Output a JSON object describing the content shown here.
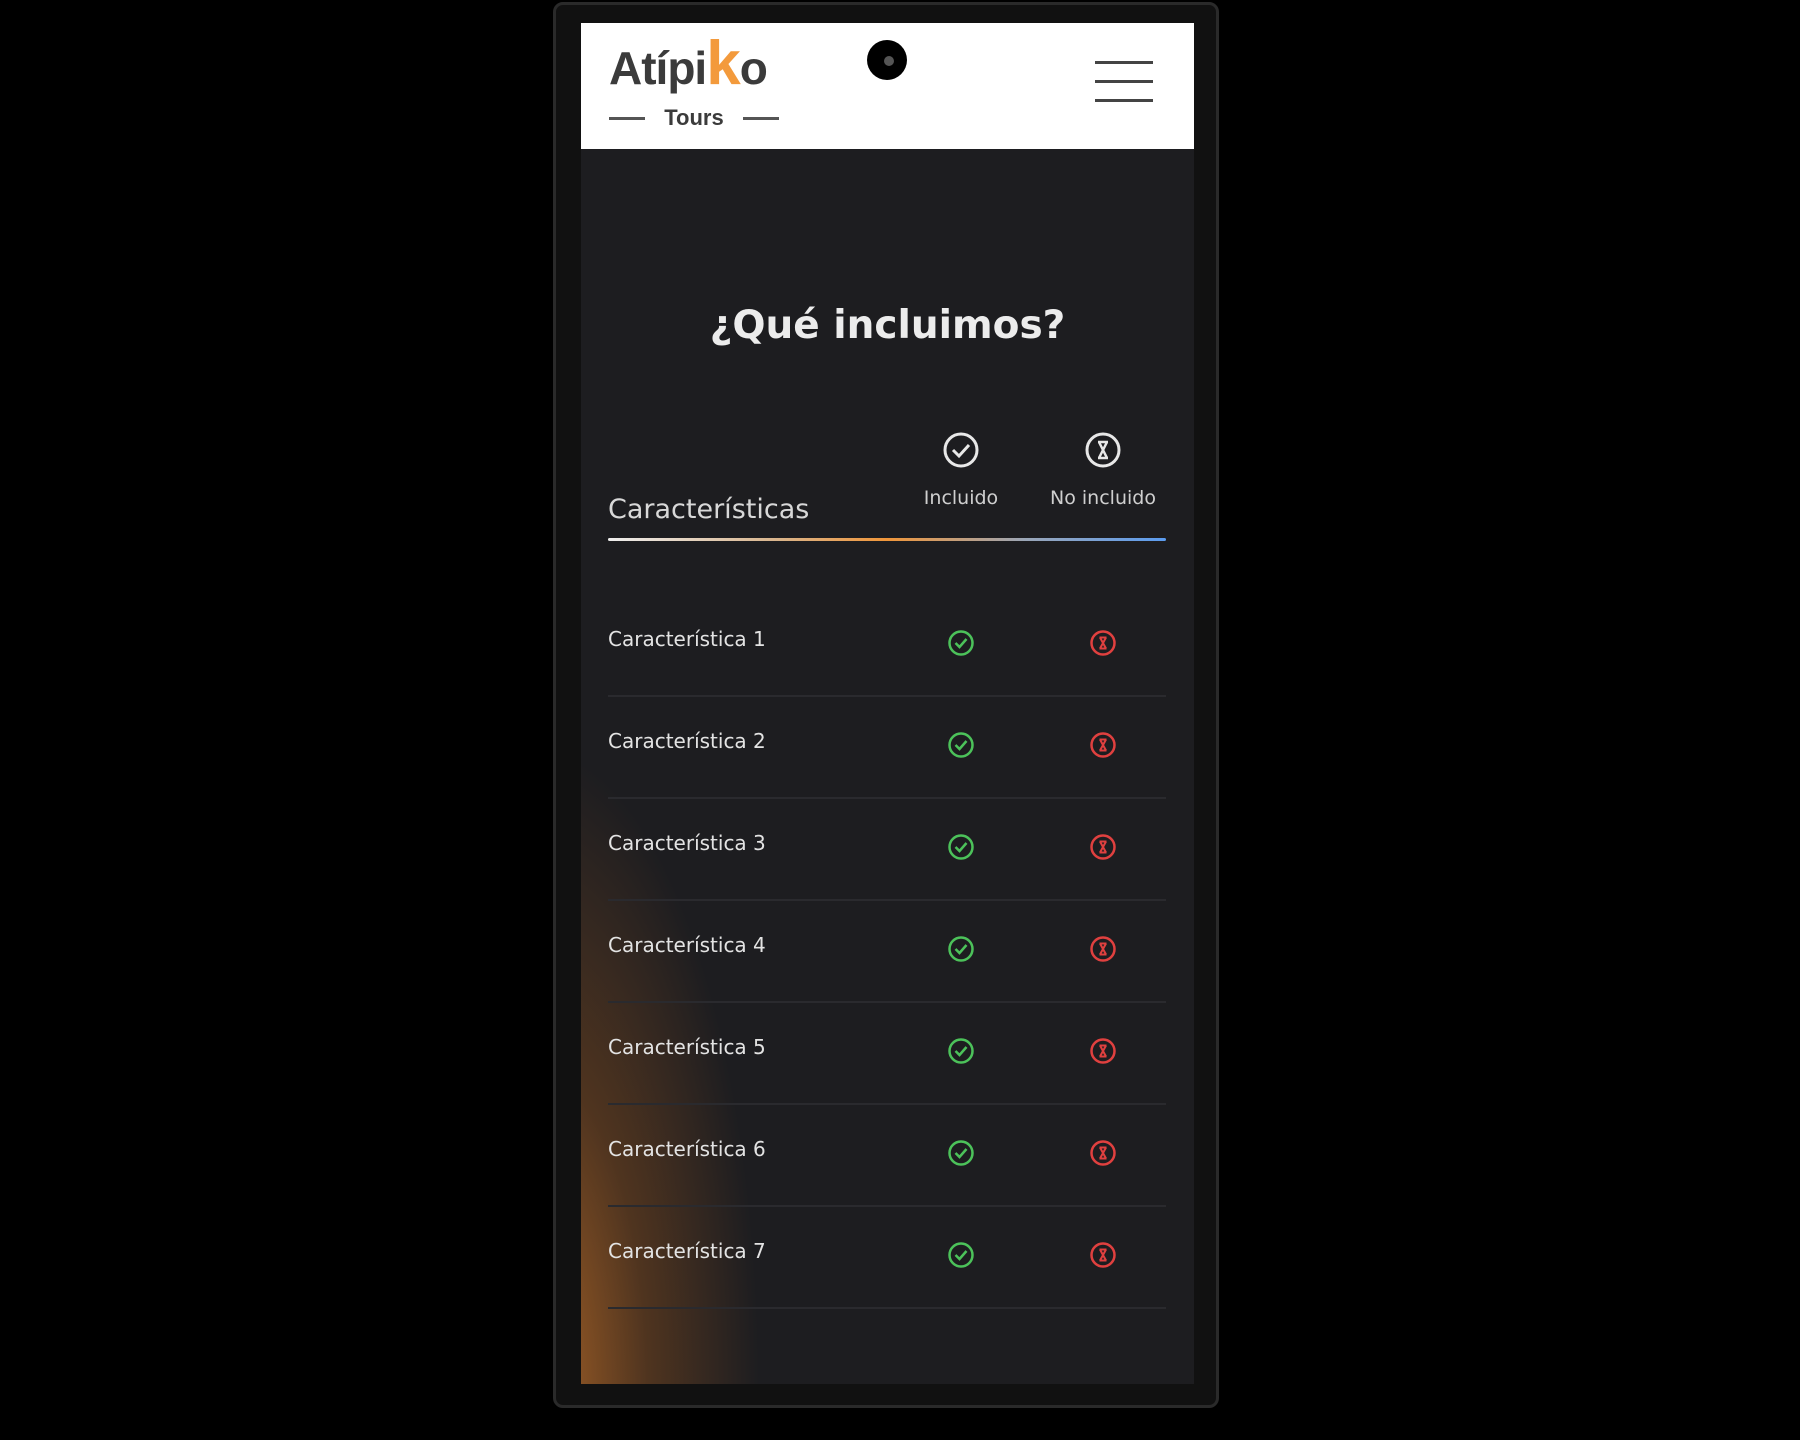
{
  "header": {
    "logo": {
      "text_main": "Atípi",
      "text_k": "k",
      "text_end": "o",
      "text_sub": "Tours"
    },
    "menu_icon": "hamburger-icon"
  },
  "section": {
    "title": "¿Qué incluimos?"
  },
  "table": {
    "feature_header": "Características",
    "columns": [
      {
        "label": "Incluido",
        "icon": "check-circle-icon"
      },
      {
        "label": "No incluido",
        "icon": "x-circle-icon"
      }
    ],
    "rows": [
      {
        "label": "Característica 1"
      },
      {
        "label": "Característica 2"
      },
      {
        "label": "Característica 3"
      },
      {
        "label": "Característica 4"
      },
      {
        "label": "Característica 5"
      },
      {
        "label": "Característica 6"
      },
      {
        "label": "Característica 7"
      }
    ]
  },
  "colors": {
    "accent": "#f39a3c",
    "included": "#4cc25a",
    "not_included": "#e0403f",
    "underline_end": "#5b9cf0",
    "background": "#1d1d20"
  }
}
